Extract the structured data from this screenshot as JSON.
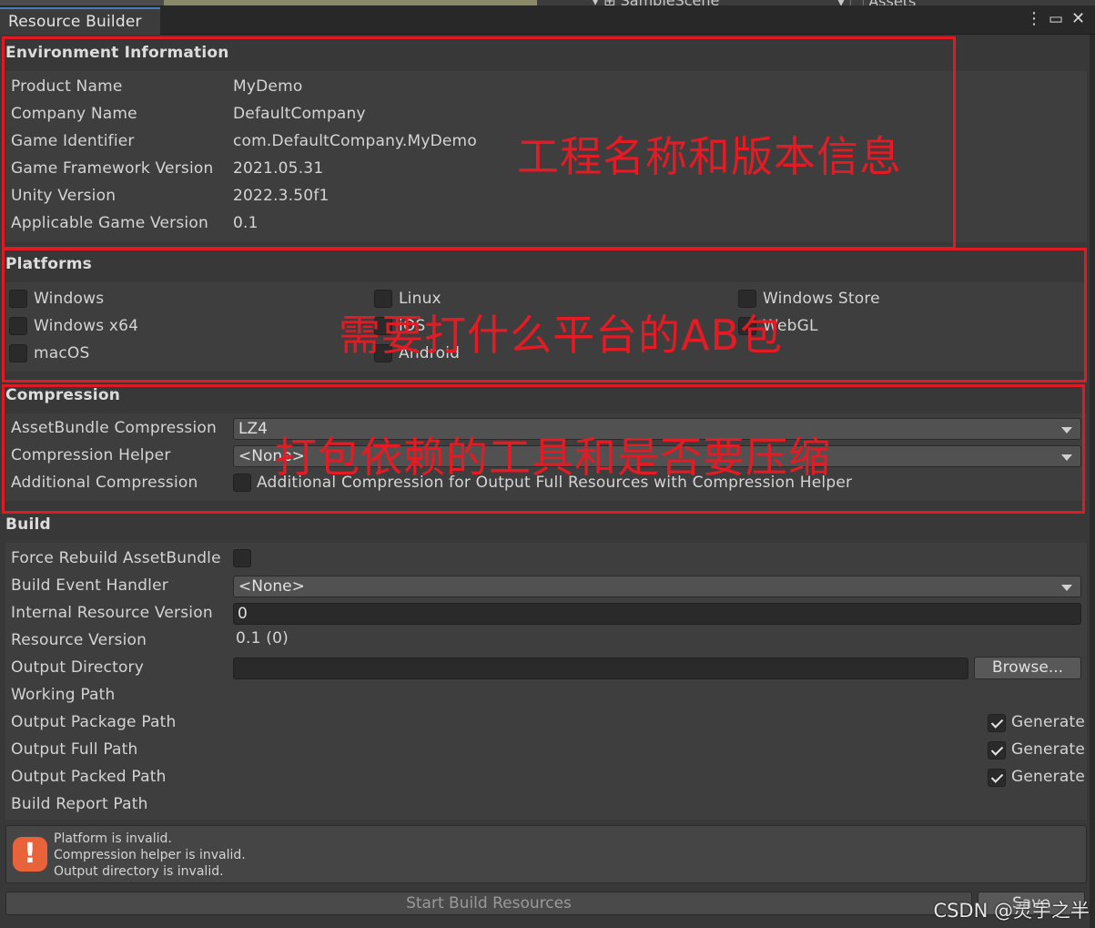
{
  "background_tabs": {
    "scene": "SampleScene",
    "assets": "Assets"
  },
  "window": {
    "title": "Resource Builder",
    "menu_icon": "kebab-menu-icon",
    "maximize_icon": "maximize-icon",
    "close_icon": "close-icon"
  },
  "environment": {
    "header": "Environment Information",
    "rows": [
      {
        "label": "Product Name",
        "value": "MyDemo"
      },
      {
        "label": "Company Name",
        "value": "DefaultCompany"
      },
      {
        "label": "Game Identifier",
        "value": "com.DefaultCompany.MyDemo"
      },
      {
        "label": "Game Framework Version",
        "value": "2021.05.31"
      },
      {
        "label": "Unity Version",
        "value": "2022.3.50f1"
      },
      {
        "label": "Applicable Game Version",
        "value": "0.1"
      }
    ]
  },
  "platforms": {
    "header": "Platforms",
    "items": [
      {
        "label": "Windows",
        "checked": false
      },
      {
        "label": "Windows x64",
        "checked": false
      },
      {
        "label": "macOS",
        "checked": false
      },
      {
        "label": "Linux",
        "checked": false
      },
      {
        "label": "iOS",
        "checked": false
      },
      {
        "label": "Android",
        "checked": false
      },
      {
        "label": "Windows Store",
        "checked": false
      },
      {
        "label": "WebGL",
        "checked": false
      }
    ]
  },
  "compression": {
    "header": "Compression",
    "assetbundle_label": "AssetBundle Compression",
    "assetbundle_value": "LZ4",
    "helper_label": "Compression Helper",
    "helper_value": "<None>",
    "additional_label": "Additional Compression",
    "additional_text": "Additional Compression for Output Full Resources with Compression Helper"
  },
  "build": {
    "header": "Build",
    "force_rebuild_label": "Force Rebuild AssetBundle",
    "event_handler_label": "Build Event Handler",
    "event_handler_value": "<None>",
    "internal_version_label": "Internal Resource Version",
    "internal_version_value": "0",
    "resource_version_label": "Resource Version",
    "resource_version_value": "0.1 (0)",
    "output_dir_label": "Output Directory",
    "output_dir_value": "",
    "browse_label": "Browse...",
    "working_path_label": "Working Path",
    "output_package_label": "Output Package Path",
    "output_full_label": "Output Full Path",
    "output_packed_label": "Output Packed Path",
    "build_report_label": "Build Report Path",
    "generate_label": "Generate"
  },
  "help": {
    "icon": "warning-icon",
    "lines": [
      "Platform is invalid.",
      "Compression helper is invalid.",
      "Output directory is invalid."
    ]
  },
  "footer": {
    "start_build_label": "Start Build Resources",
    "save_label": "Save"
  },
  "annotations": {
    "color": "#e01a22",
    "environment": "工程名称和版本信息",
    "platforms": "需要打什么平台的AB包",
    "compression": "打包依赖的工具和是否要压缩"
  },
  "watermark": "CSDN @灵宇之半"
}
